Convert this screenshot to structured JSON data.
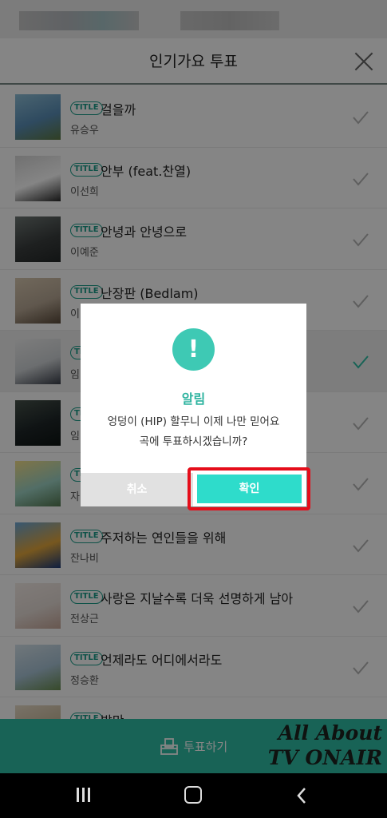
{
  "header": {
    "title": "인기가요 투표"
  },
  "songs": [
    {
      "badge": "TITLE",
      "title": "걸을까",
      "artist": "유승우",
      "colors": [
        "#5a8fb8",
        "#8fc0d8",
        "#5e7a45"
      ],
      "selected": false
    },
    {
      "badge": "TITLE",
      "title": "안부 (feat.찬열)",
      "artist": "이선희",
      "colors": [
        "#ffffff",
        "#d8d8d8",
        "#2a2a2a"
      ],
      "selected": false
    },
    {
      "badge": "TITLE",
      "title": "안녕과 안녕으로",
      "artist": "이예준",
      "colors": [
        "#3b3f3f",
        "#6e7774",
        "#242828"
      ],
      "selected": false
    },
    {
      "badge": "TITLE",
      "title": "난장판 (Bedlam)",
      "artist": "이",
      "colors": [
        "#b8a895",
        "#d8c8b0",
        "#5a4a3a"
      ],
      "selected": false
    },
    {
      "badge": "TITLE",
      "title": "",
      "artist": "임",
      "colors": [
        "#cfd3d6",
        "#f0f0f0",
        "#3a3f4a"
      ],
      "selected": true
    },
    {
      "badge": "TITLE",
      "title": "",
      "artist": "임",
      "colors": [
        "#1e2628",
        "#46524a",
        "#0e1412"
      ],
      "selected": false
    },
    {
      "badge": "TITLE",
      "title": "",
      "artist": "자",
      "colors": [
        "#9ed3c4",
        "#f4e08a",
        "#557a52"
      ],
      "selected": false
    },
    {
      "badge": "TITLE",
      "title": "주저하는 연인들을 위해",
      "artist": "잔나비",
      "colors": [
        "#e4a83c",
        "#6aa8d8",
        "#1d3b7a"
      ],
      "selected": false
    },
    {
      "badge": "TITLE",
      "title": "사랑은 지날수록 더욱 선명하게 남아",
      "artist": "전상근",
      "colors": [
        "#e6dcd6",
        "#f5ede8",
        "#c8a89a"
      ],
      "selected": false
    },
    {
      "badge": "TITLE",
      "title": "언제라도 어디에서라도",
      "artist": "정승환",
      "colors": [
        "#a9c4d6",
        "#d7e4ec",
        "#6a8e52"
      ],
      "selected": false
    },
    {
      "badge": "TITLE",
      "title": "밤만",
      "artist": "",
      "colors": [
        "#c8b89a",
        "#e8dcc8",
        "#5a4a3a"
      ],
      "selected": false
    }
  ],
  "vote_bar": {
    "label": "투표하기",
    "watermark_line1": "All About",
    "watermark_line2": "TV ONAIR"
  },
  "dialog": {
    "icon": "!",
    "title": "알림",
    "message_line1": "엉덩이 (HIP) 할무니 이제 나만 믿어요",
    "message_line2": "곡에 투표하시겠습니까?",
    "cancel_label": "취소",
    "confirm_label": "확인"
  },
  "colors": {
    "accent": "#2ebfa6",
    "confirm": "#2edccb",
    "highlight": "#e50d1a"
  }
}
